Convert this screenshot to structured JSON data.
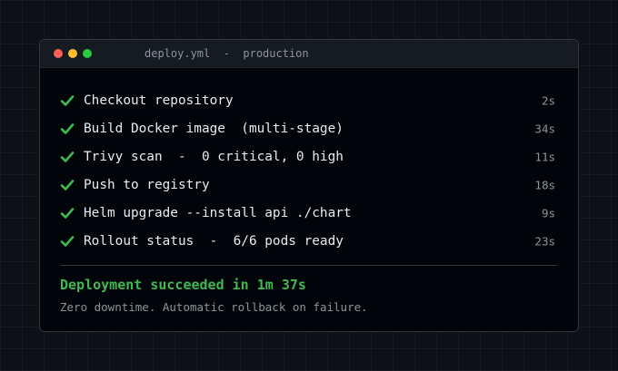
{
  "window": {
    "title": "deploy.yml  -  production"
  },
  "steps": [
    {
      "label": "Checkout repository",
      "duration": "2s",
      "status": "success"
    },
    {
      "label": "Build Docker image  (multi-stage)",
      "duration": "34s",
      "status": "success"
    },
    {
      "label": "Trivy scan  -  0 critical, 0 high",
      "duration": "11s",
      "status": "success"
    },
    {
      "label": "Push to registry",
      "duration": "18s",
      "status": "success"
    },
    {
      "label": "Helm upgrade --install api ./chart",
      "duration": "9s",
      "status": "success"
    },
    {
      "label": "Rollout status  -  6/6 pods ready",
      "duration": "23s",
      "status": "success"
    }
  ],
  "summary": {
    "headline": "Deployment succeeded in 1m 37s",
    "detail": "Zero downtime. Automatic rollback on failure."
  },
  "colors": {
    "success": "#3fb950",
    "background": "#010409"
  },
  "icons": {
    "step_status": "checkmark-icon"
  }
}
